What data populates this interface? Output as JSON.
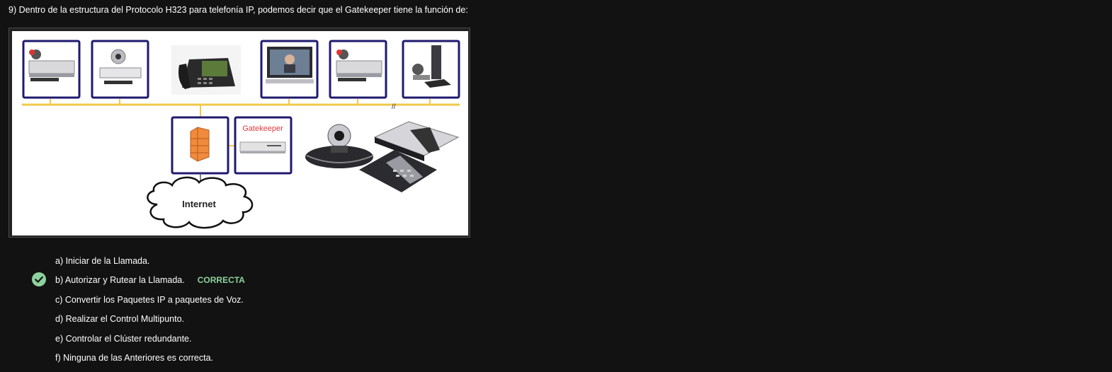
{
  "question": {
    "text": "9) Dentro de la estructura del Protocolo H323 para telefonía IP, podemos decir que el Gatekeeper tiene la función de:"
  },
  "figure": {
    "gatekeeper_label": "Gatekeeper",
    "internet_label": "Internet",
    "break_mark": "//"
  },
  "options": [
    {
      "label": "a) Iniciar de la Llamada.",
      "selected": false
    },
    {
      "label": "b) Autorizar y Rutear la Llamada.",
      "selected": true,
      "tag": "CORRECTA"
    },
    {
      "label": "c) Convertir los Paquetes IP a paquetes de Voz.",
      "selected": false
    },
    {
      "label": "d) Realizar el Control Multipunto.",
      "selected": false
    },
    {
      "label": "e) Controlar el Clúster redundante.",
      "selected": false
    },
    {
      "label": "f) Ninguna de las Anteriores es correcta.",
      "selected": false
    }
  ],
  "colors": {
    "background": "#121212",
    "correct": "#8fd19e",
    "bus_line": "#f2c84b",
    "device_border": "#1f1a6e",
    "gatekeeper_text": "#e0393e"
  }
}
